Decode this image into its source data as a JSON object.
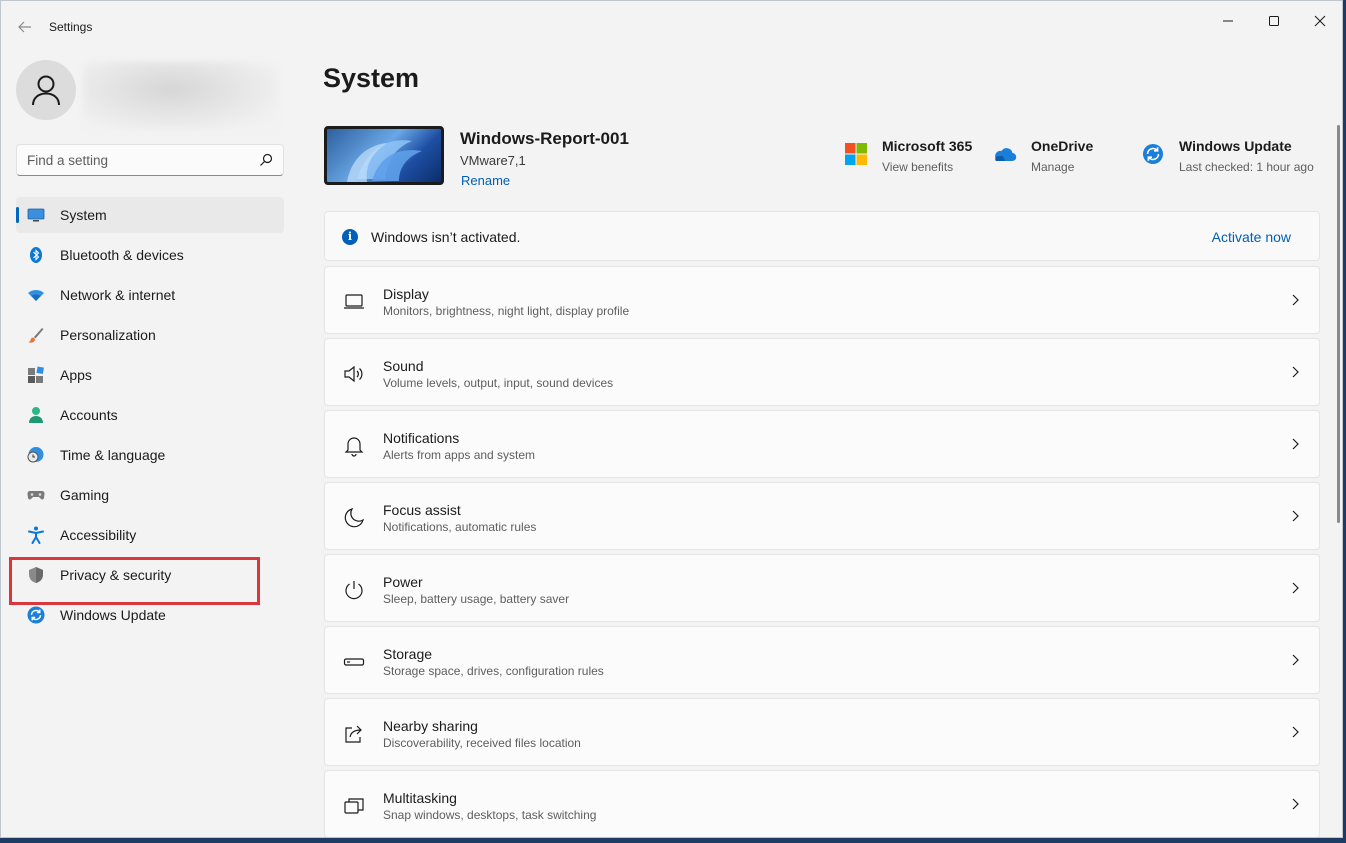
{
  "window": {
    "title": "Settings",
    "controls": [
      "minimize-icon",
      "maximize-icon",
      "close-icon"
    ]
  },
  "search": {
    "placeholder": "Find a setting",
    "icon": "search-icon"
  },
  "sidebar": {
    "items": [
      {
        "label": "System",
        "icon": "monitor-icon",
        "active": true
      },
      {
        "label": "Bluetooth & devices",
        "icon": "bluetooth-icon"
      },
      {
        "label": "Network & internet",
        "icon": "wifi-icon"
      },
      {
        "label": "Personalization",
        "icon": "brush-icon"
      },
      {
        "label": "Apps",
        "icon": "apps-icon"
      },
      {
        "label": "Accounts",
        "icon": "person-icon"
      },
      {
        "label": "Time & language",
        "icon": "globe-clock-icon"
      },
      {
        "label": "Gaming",
        "icon": "gamepad-icon"
      },
      {
        "label": "Accessibility",
        "icon": "accessibility-icon"
      },
      {
        "label": "Privacy & security",
        "icon": "shield-icon",
        "highlighted": true
      },
      {
        "label": "Windows Update",
        "icon": "sync-icon"
      }
    ]
  },
  "main": {
    "title": "System",
    "device": {
      "name": "Windows-Report-001",
      "model": "VMware7,1",
      "rename_label": "Rename"
    },
    "quick_links": [
      {
        "title": "Microsoft 365",
        "subtitle": "View benefits",
        "icon": "microsoft-logo-icon"
      },
      {
        "title": "OneDrive",
        "subtitle": "Manage",
        "icon": "cloud-icon"
      },
      {
        "title": "Windows Update",
        "subtitle": "Last checked: 1 hour ago",
        "icon": "sync-icon"
      }
    ],
    "activation": {
      "message": "Windows isn’t activated.",
      "action": "Activate now",
      "icon": "info-icon"
    },
    "cards": [
      {
        "title": "Display",
        "subtitle": "Monitors, brightness, night light, display profile",
        "icon": "display-icon"
      },
      {
        "title": "Sound",
        "subtitle": "Volume levels, output, input, sound devices",
        "icon": "speaker-icon"
      },
      {
        "title": "Notifications",
        "subtitle": "Alerts from apps and system",
        "icon": "bell-icon"
      },
      {
        "title": "Focus assist",
        "subtitle": "Notifications, automatic rules",
        "icon": "moon-icon"
      },
      {
        "title": "Power",
        "subtitle": "Sleep, battery usage, battery saver",
        "icon": "power-icon"
      },
      {
        "title": "Storage",
        "subtitle": "Storage space, drives, configuration rules",
        "icon": "storage-icon"
      },
      {
        "title": "Nearby sharing",
        "subtitle": "Discoverability, received files location",
        "icon": "share-icon"
      },
      {
        "title": "Multitasking",
        "subtitle": "Snap windows, desktops, task switching",
        "icon": "multitasking-icon"
      }
    ]
  },
  "colors": {
    "accent": "#0067c0",
    "link": "#005fb8",
    "highlight_box": "#d9363e"
  }
}
